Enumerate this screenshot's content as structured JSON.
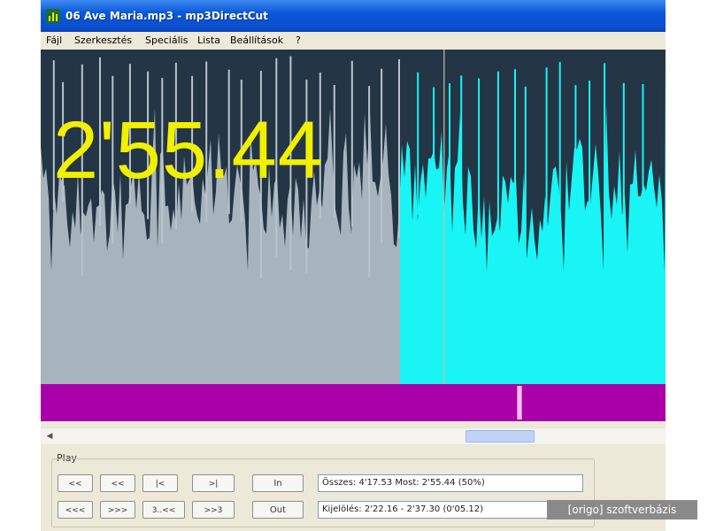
{
  "window": {
    "title": "06 Ave Maria.mp3 - mp3DirectCut",
    "icon": "app-icon"
  },
  "menu": {
    "items": [
      "Fájl",
      "Szerkesztés",
      "Speciális",
      "Lista",
      "Beállítások",
      "?"
    ]
  },
  "waveform": {
    "time_readout": "2'55.44",
    "selection_start_fraction": 0.575,
    "cursor_fraction": 0.645,
    "colors": {
      "background": "#243545",
      "unselected_top": "#a7b4bd",
      "unselected_peaks": "#b9c4cc",
      "selected_top": "#19f4f4",
      "readout": "#f0f000"
    }
  },
  "timeline": {
    "marker_fraction": 0.762,
    "color": "#a900a9"
  },
  "scrollbar": {
    "thumb_start_fraction": 0.68,
    "thumb_width_fraction": 0.11
  },
  "controls": {
    "group_label": "Play",
    "row1_buttons": [
      "<<",
      "<<",
      "|<",
      ">|"
    ],
    "row2_buttons": [
      "<<<",
      ">>>",
      "3..<<",
      ">>3"
    ],
    "in_label": "In",
    "out_label": "Out",
    "info_total": "Összes: 4'17.53  Most: 2'55.44  (50%)",
    "info_selection": "Kijelölés: 2'22.16 - 2'37.30 (0'05.12)"
  },
  "watermark": {
    "text": "[origo] szoftverbázis"
  }
}
